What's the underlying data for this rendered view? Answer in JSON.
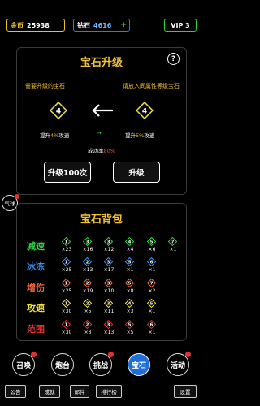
{
  "topbar": {
    "gold_label": "金币",
    "gold_value": "25938",
    "gem_label": "钻石",
    "gem_value": "4616",
    "gem_plus": "+",
    "vip_label": "VIP 3"
  },
  "upgrade": {
    "title": "宝石升级",
    "help": "?",
    "left_caption": "需要升级的宝石",
    "right_caption": "请放入同属性等级宝石",
    "left_level": "4",
    "right_level": "4",
    "left_boost_prefix": "提升",
    "left_boost_pct": "4%",
    "left_boost_suffix": "攻速",
    "right_boost_prefix": "提升",
    "right_boost_pct": "5%",
    "right_boost_suffix": "攻速",
    "mid_arrow": "→",
    "rate_label": "成功率",
    "rate_value": "80%",
    "btn_100": "升级100次",
    "btn_once": "升级"
  },
  "float_label": "气球",
  "bag": {
    "title": "宝石背包",
    "rows": [
      {
        "label": "减速",
        "color": "#2fd13a",
        "cells": [
          [
            "1",
            "×23"
          ],
          [
            "3",
            "×16"
          ],
          [
            "3",
            "×12"
          ],
          [
            "4",
            "×4"
          ],
          [
            "5",
            "×6"
          ],
          [
            "7",
            "×1"
          ]
        ]
      },
      {
        "label": "冰冻",
        "color": "#3a8ff2",
        "cells": [
          [
            "1",
            "×25"
          ],
          [
            "2",
            "×13"
          ],
          [
            "3",
            "×17"
          ],
          [
            "5",
            "×1"
          ],
          [
            "6",
            "×1"
          ]
        ]
      },
      {
        "label": "增伤",
        "color": "#f26a3a",
        "cells": [
          [
            "1",
            "×25"
          ],
          [
            "2",
            "×19"
          ],
          [
            "3",
            "×10"
          ],
          [
            "5",
            "×8"
          ],
          [
            "7",
            "×2"
          ]
        ]
      },
      {
        "label": "攻速",
        "color": "#f2e23a",
        "cells": [
          [
            "1",
            "×30"
          ],
          [
            "2",
            "×5"
          ],
          [
            "3",
            "×11"
          ],
          [
            "4",
            "×3"
          ],
          [
            "5",
            "×1"
          ]
        ]
      },
      {
        "label": "范围",
        "color": "#e02e2e",
        "cells": [
          [
            "1",
            "×30"
          ],
          [
            "2",
            "×3"
          ],
          [
            "3",
            "×13"
          ],
          [
            "5",
            "×5"
          ],
          [
            "6",
            "×1"
          ]
        ]
      }
    ]
  },
  "nav": {
    "summon": "召唤",
    "turret": "炮台",
    "challenge": "挑战",
    "gem": "宝石",
    "event": "活动"
  },
  "bottom": {
    "notice": "公告",
    "achievement": "成就",
    "mail": "邮件",
    "rank": "排行榜",
    "settings": "设置"
  }
}
